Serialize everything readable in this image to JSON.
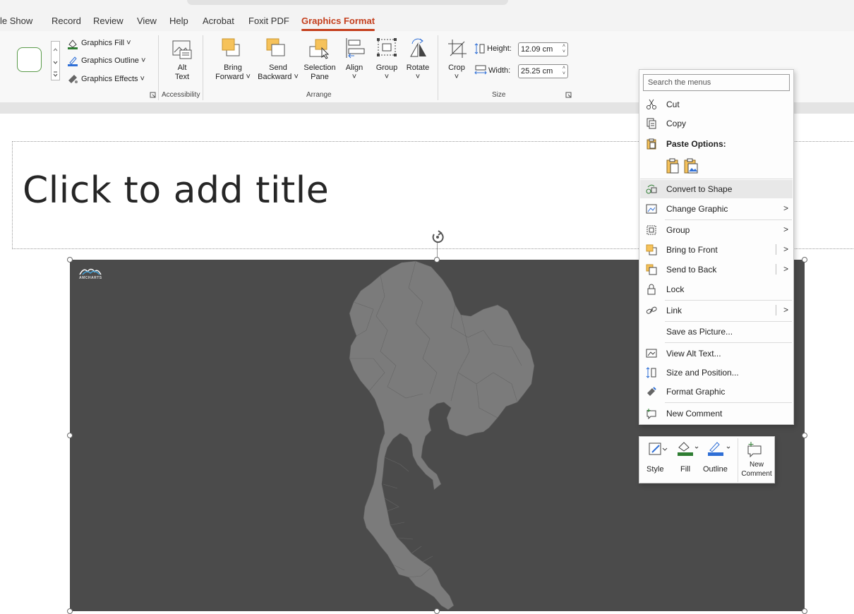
{
  "tabs": [
    "le Show",
    "Record",
    "Review",
    "View",
    "Help",
    "Acrobat",
    "Foxit PDF",
    "Graphics Format"
  ],
  "ribbon": {
    "styles": {
      "fill": "Graphics Fill",
      "outline": "Graphics Outline",
      "effects": "Graphics Effects"
    },
    "accessibility": {
      "alt_text": [
        "Alt",
        "Text"
      ],
      "group": "Accessibility"
    },
    "arrange": {
      "bring_forward": [
        "Bring",
        "Forward"
      ],
      "send_backward": [
        "Send",
        "Backward"
      ],
      "selection_pane": [
        "Selection",
        "Pane"
      ],
      "align": "Align",
      "group_btn": "Group",
      "rotate": "Rotate",
      "group": "Arrange"
    },
    "size": {
      "crop": "Crop",
      "height_label": "Height:",
      "height_value": "12.09 cm",
      "width_label": "Width:",
      "width_value": "25.25 cm",
      "group": "Size"
    }
  },
  "slide": {
    "title_placeholder": "Click to add title",
    "logo_text": "AMCHARTS"
  },
  "context_menu": {
    "search_placeholder": "Search the menus",
    "items": {
      "cut": "Cut",
      "copy": "Copy",
      "paste_options": "Paste Options:",
      "convert": "Convert to Shape",
      "change_graphic": "Change Graphic",
      "group": "Group",
      "bring_front": "Bring to Front",
      "send_back": "Send to Back",
      "lock": "Lock",
      "link": "Link",
      "save_picture": "Save as Picture...",
      "alt_text": "View Alt Text...",
      "size_position": "Size and Position...",
      "format_graphic": "Format Graphic",
      "new_comment": "New Comment"
    }
  },
  "mini_toolbar": {
    "style": "Style",
    "fill": "Fill",
    "outline": "Outline",
    "new_comment": [
      "New",
      "Comment"
    ]
  },
  "colors": {
    "accent": "#c43e1c",
    "slide_graphic_bg": "#4b4b4b",
    "map_fill": "#7b7b7b",
    "fill_green": "#2e7d32",
    "outline_blue": "#2f6fd6",
    "shape_orange": "#f6c25a"
  },
  "icons": {
    "chevron": ">"
  }
}
